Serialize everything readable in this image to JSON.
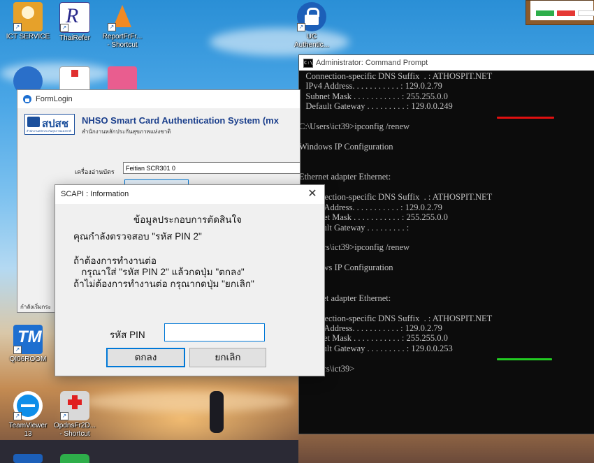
{
  "desktop": {
    "icons": [
      {
        "name": "ict-service",
        "label": "ICT SERVICE"
      },
      {
        "name": "thairefer",
        "label": "ThaiRefer"
      },
      {
        "name": "reportfrfr",
        "label": "ReportFrFr...\n- Shortcut"
      },
      {
        "name": "uc-authentic",
        "label": "UC\nAuthentic..."
      },
      {
        "name": "qi06room",
        "label": "QI06ROOM"
      },
      {
        "name": "teamviewer",
        "label": "TeamViewer\n13"
      },
      {
        "name": "opdnsfr2d",
        "label": "OpdnsFr2D...\n- Shortcut"
      }
    ]
  },
  "cmd": {
    "title": "Administrator: Command Prompt",
    "icon_text": "C:\\",
    "lines": [
      "   Connection-specific DNS Suffix  . : ATHOSPIT.NET",
      "   IPv4 Address. . . . . . . . . . . : 129.0.2.79",
      "   Subnet Mask . . . . . . . . . . . : 255.255.0.0",
      "   Default Gateway . . . . . . . . . : 129.0.0.249",
      "",
      "C:\\Users\\ict39>ipconfig /renew",
      "",
      "Windows IP Configuration",
      "",
      "",
      "Ethernet adapter Ethernet:",
      "",
      "   Connection-specific DNS Suffix  . : ATHOSPIT.NET",
      "   IPv4 Address. . . . . . . . . . . : 129.0.2.79",
      "   Subnet Mask . . . . . . . . . . . : 255.255.0.0",
      "   Default Gateway . . . . . . . . . :",
      "",
      "C:\\Users\\ict39>ipconfig /renew",
      "",
      "Windows IP Configuration",
      "",
      "",
      "Ethernet adapter Ethernet:",
      "",
      "   Connection-specific DNS Suffix  . : ATHOSPIT.NET",
      "   IPv4 Address. . . . . . . . . . . : 129.0.2.79",
      "   Subnet Mask . . . . . . . . . . . : 255.255.0.0",
      "   Default Gateway . . . . . . . . . : 129.0.0.253",
      "",
      "C:\\Users\\ict39>"
    ],
    "underline_colors": {
      "first": "#e01010",
      "second": "#22cc22"
    }
  },
  "formlogin": {
    "title": "FormLogin",
    "logo_text": "สปสช",
    "logo_sub": "สำนักงานหลักประกันสุขภาพแห่งชาติ",
    "app_title": "NHSO Smart Card  Authentication System (mx",
    "app_subtitle": "สำนักงานหลักประกันสุขภาพแห่งชาติ",
    "reader_label": "เครื่องอ่านบัตร",
    "reader_value": "Feitian SCR301 0",
    "status_text": "กำลังเริ่มกระ"
  },
  "dialog": {
    "title": "SCAPI : Information",
    "heading": "ข้อมูลประกอบการตัดสินใจ",
    "line1": "คุณกำลังตรวจสอบ \"รหัส PIN 2\"",
    "line2": "ถ้าต้องการทำงานต่อ",
    "line3": "   กรุณาใส่ \"รหัส PIN 2\" แล้วกดปุ่ม \"ตกลง\"",
    "line4": "ถ้าไม่ต้องการทำงานต่อ กรุณากดปุ่ม \"ยกเลิก\"",
    "pin_label": "รหัส PIN",
    "pin_value": "",
    "ok_label": "ตกลง",
    "cancel_label": "ยกเลิก",
    "close_glyph": "✕"
  }
}
